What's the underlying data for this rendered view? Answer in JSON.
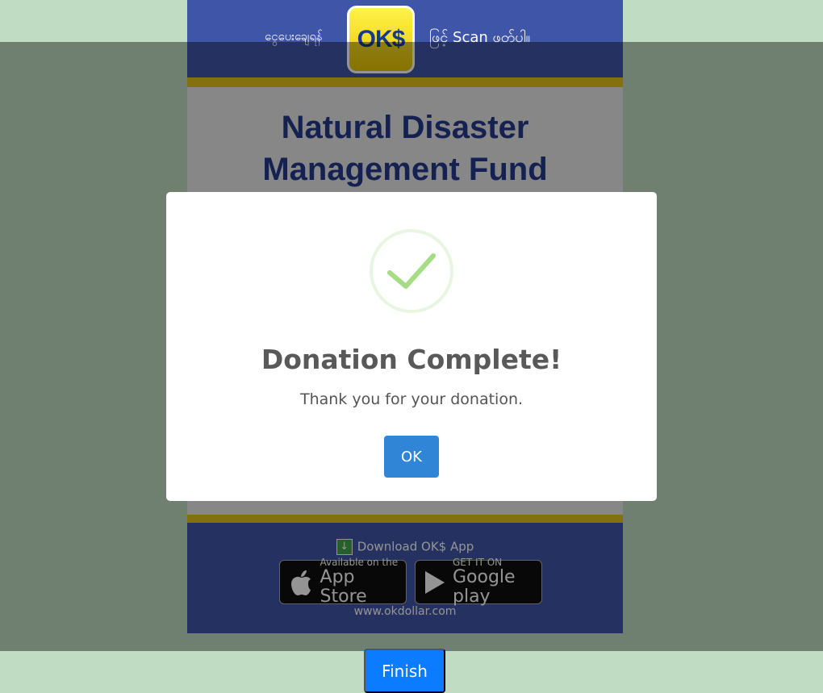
{
  "poster": {
    "top_left_text": "ငွေပေးချေရန်",
    "logo_text": "OK$",
    "top_right_text": "ဖြင့် Scan ဖတ်ပါ။",
    "headline_line1": "Natural Disaster",
    "headline_line2": "Management Fund",
    "download_text": "Download OK$ App",
    "app_store_small": "Available on the",
    "app_store_big": "App Store",
    "google_small": "GET IT ON",
    "google_big": "Google play",
    "website": "www.okdollar.com"
  },
  "modal": {
    "icon": "success-check-icon",
    "title": "Donation Complete!",
    "message": "Thank you for your donation.",
    "ok_label": "OK"
  },
  "footer": {
    "finish_label": "Finish"
  },
  "colors": {
    "page_background": "#c0ddc3",
    "poster_blue": "#3f55a8",
    "poster_gold": "#e2c21b",
    "success_green": "#a5dc86",
    "ok_button": "#3085d6",
    "finish_button": "#0b7cff"
  }
}
